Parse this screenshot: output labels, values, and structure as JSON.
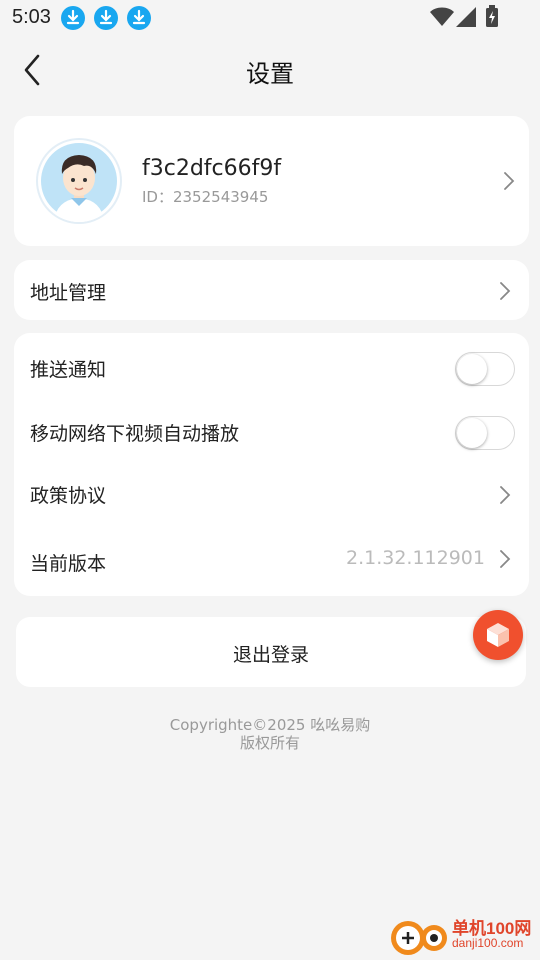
{
  "status": {
    "time": "5:03",
    "icons": [
      "download-icon",
      "download-icon",
      "download-icon",
      "wifi-icon",
      "signal-icon",
      "battery-icon"
    ]
  },
  "nav": {
    "title": "设置",
    "back_icon": "chevron-left-icon"
  },
  "profile": {
    "username": "f3c2dfc66f9f",
    "id_label": "ID：2352543945",
    "avatar_icon": "user-avatar-icon"
  },
  "address": {
    "label": "地址管理"
  },
  "settings": {
    "push_label": "推送通知",
    "push_on": false,
    "autoplay_label": "移动网络下视频自动播放",
    "autoplay_on": false,
    "policy_label": "政策协议",
    "version_label": "当前版本",
    "version_value": "2.1.32.112901"
  },
  "logout": {
    "label": "退出登录"
  },
  "float_button": {
    "icon": "cube-icon",
    "color": "#f0502e"
  },
  "footer": {
    "line1": "Copyrighte©2025 吆吆易购",
    "line2": "版权所有"
  },
  "watermark": {
    "text1": "单机100网",
    "text2": "danji100.com"
  },
  "colors": {
    "accent_download": "#19a7f0",
    "background": "#f4f4f4"
  }
}
